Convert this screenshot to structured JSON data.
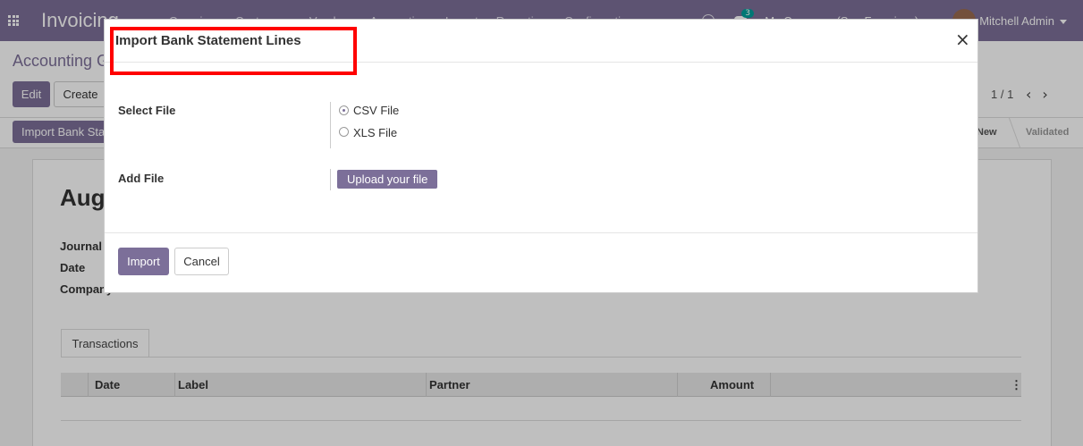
{
  "navbar": {
    "brand": "Invoicing",
    "menu": [
      "Overview",
      "Customers",
      "Vendors",
      "Accounting",
      "Import",
      "Reporting",
      "Configuration"
    ],
    "chat_badge": "3",
    "company": "My Company (San Francisco)",
    "user": "Mitchell Admin"
  },
  "control": {
    "breadcrumb": "Accounting G",
    "edit_label": "Edit",
    "create_label": "Create",
    "pager": "1 / 1"
  },
  "statusbar": {
    "import_bank_label": "Import Bank Statement",
    "stages": [
      "New",
      "Validated"
    ]
  },
  "record": {
    "title": "Aug",
    "fields": [
      "Journal",
      "Date",
      "Company"
    ],
    "tab": "Transactions",
    "columns": [
      "Date",
      "Label",
      "Partner",
      "Amount"
    ]
  },
  "modal": {
    "title": "Import Bank Statement Lines",
    "close_glyph": "×",
    "select_file_label": "Select File",
    "options": [
      {
        "label": "CSV File",
        "checked": true
      },
      {
        "label": "XLS File",
        "checked": false
      }
    ],
    "add_file_label": "Add File",
    "upload_label": "Upload your file",
    "import_label": "Import",
    "cancel_label": "Cancel"
  },
  "colors": {
    "brand": "#7c6f99",
    "highlight": "#ff0000"
  }
}
